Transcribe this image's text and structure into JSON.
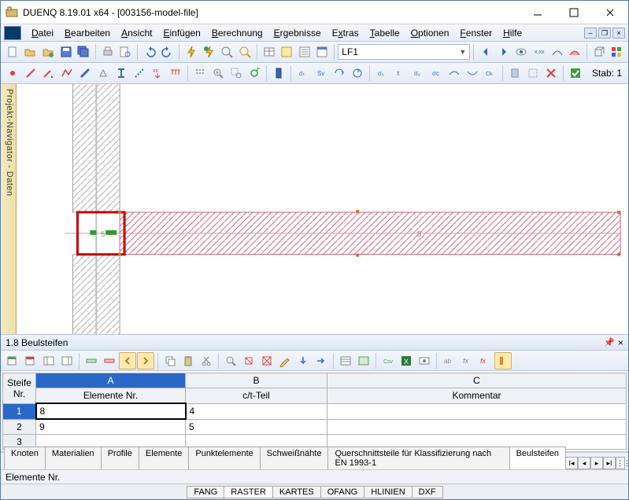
{
  "title": "DUENQ 8.19.01 x64 - [003156-model-file]",
  "menus": [
    "Datei",
    "Bearbeiten",
    "Ansicht",
    "Einfügen",
    "Berechnung",
    "Ergebnisse",
    "Extras",
    "Tabelle",
    "Optionen",
    "Fenster",
    "Hilfe"
  ],
  "menu_underline_idx": [
    0,
    0,
    0,
    0,
    0,
    0,
    1,
    0,
    0,
    0,
    0
  ],
  "combo_value": "LF1",
  "stab_label": "Stab: 1",
  "side_tab": "Projekt-Navigator - Daten",
  "panel_title": "1.8 Beulsteifen",
  "grid": {
    "col_nr_header": "Steife Nr.",
    "col_letters": [
      "A",
      "B",
      "C"
    ],
    "col_headers": [
      "Elemente Nr.",
      "c/t-Teil",
      "Kommentar"
    ],
    "rows": [
      {
        "nr": "1",
        "a": "8",
        "b": "4",
        "c": ""
      },
      {
        "nr": "2",
        "a": "9",
        "b": "5",
        "c": ""
      },
      {
        "nr": "3",
        "a": "",
        "b": "",
        "c": ""
      }
    ]
  },
  "bottom_tabs": [
    "Knoten",
    "Materialien",
    "Profile",
    "Elemente",
    "Punktelemente",
    "Schweißnähte",
    "Querschnittsteile für Klassifizierung nach EN 1993-1",
    "Beulsteifen"
  ],
  "bottom_tabs_active_index": 7,
  "status_text": "Elemente Nr.",
  "footer_tabs": [
    "FANG",
    "RASTER",
    "KARTES",
    "OFANG",
    "HLINIEN",
    "DXF"
  ],
  "footer_active_index": 1,
  "canvas_label": "8",
  "selection_label": "5",
  "icons": {
    "new": "new-icon",
    "open": "open-icon",
    "save": "save-icon"
  },
  "colors": {
    "accent": "#2a68c8",
    "hatch": "#cc6680",
    "highlight_border": "#c00000"
  }
}
